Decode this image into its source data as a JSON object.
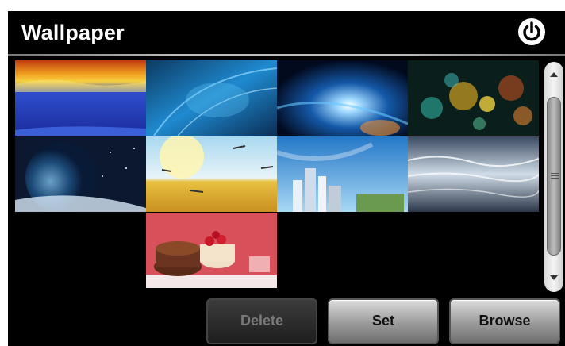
{
  "header": {
    "title": "Wallpaper",
    "power_icon": "power-icon"
  },
  "wallpapers": [
    {
      "name": "sunset-fire-sky"
    },
    {
      "name": "blue-abstract-swirl"
    },
    {
      "name": "blue-light-burst"
    },
    {
      "name": "bokeh-lights"
    },
    {
      "name": "earth-from-space"
    },
    {
      "name": "wheat-field-dragonflies"
    },
    {
      "name": "city-skyline-blue"
    },
    {
      "name": "silver-waves"
    },
    {
      "name": "strawberry-cakes"
    }
  ],
  "buttons": {
    "delete": "Delete",
    "set": "Set",
    "browse": "Browse"
  },
  "colors": {
    "background": "#000000",
    "title": "#ffffff",
    "disabled_text": "#7a7a7a"
  }
}
